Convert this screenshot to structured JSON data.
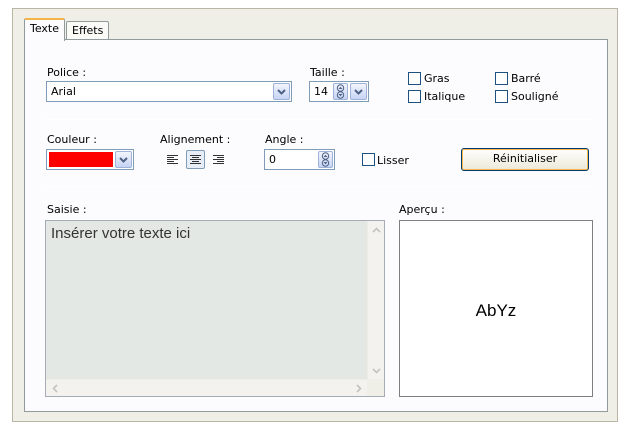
{
  "tabs": [
    {
      "label": "Texte",
      "active": true
    },
    {
      "label": "Effets",
      "active": false
    }
  ],
  "font": {
    "label": "Police :",
    "value": "Arial"
  },
  "size": {
    "label": "Taille :",
    "value": "14"
  },
  "styles": {
    "bold": {
      "label": "Gras",
      "checked": false
    },
    "italic": {
      "label": "Italique",
      "checked": false
    },
    "strike": {
      "label": "Barré",
      "checked": false
    },
    "underline": {
      "label": "Souligné",
      "checked": false
    }
  },
  "color": {
    "label": "Couleur :",
    "value": "#ff0000"
  },
  "alignment": {
    "label": "Alignement :",
    "options": [
      "left",
      "center",
      "right"
    ],
    "selected": "center"
  },
  "angle": {
    "label": "Angle :",
    "value": "0"
  },
  "smooth": {
    "label": "Lisser",
    "checked": false
  },
  "reset_button": "Réinitialiser",
  "input": {
    "label": "Saisie :",
    "value": "Insérer votre texte ici"
  },
  "preview": {
    "label": "Aperçu :",
    "text": "AbYz"
  }
}
